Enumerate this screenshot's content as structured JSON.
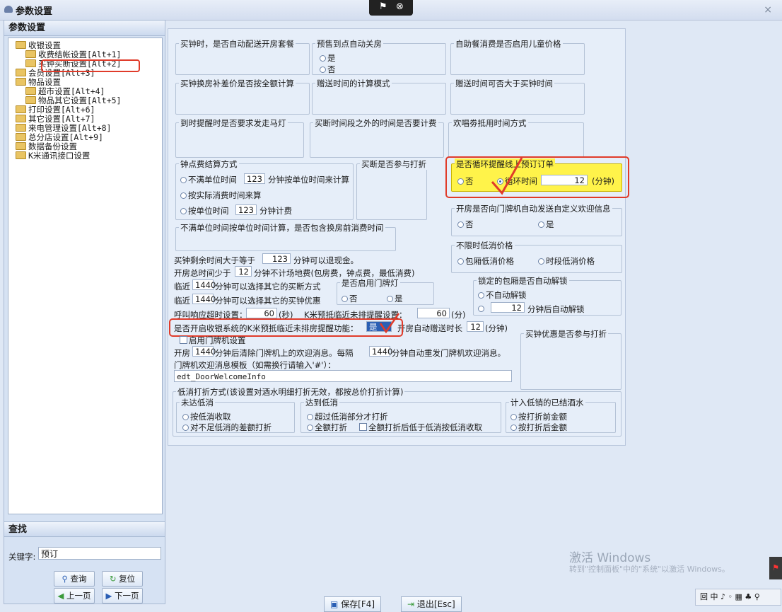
{
  "window": {
    "title": "参数设置",
    "close_glyph": "×",
    "rec_icon1": "⚑",
    "rec_icon2": "⊗"
  },
  "left": {
    "header": "参数设置",
    "tree": [
      "收银设置",
      "收费结帐设置[Alt+1]",
      "买钟买断设置[Alt+2]",
      "会员设置[Alt+3]",
      "物品设置",
      "超市设置[Alt+4]",
      "物品其它设置[Alt+5]",
      "打印设置[Alt+6]",
      "其它设置[Alt+7]",
      "来电管理设置[Alt+8]",
      "总分店设置[Alt+9]",
      "数据备份设置",
      "K米通讯接口设置"
    ],
    "search_header": "查找",
    "keyword_label": "关键字:",
    "keyword_value": "预订",
    "query_btn": "查询",
    "reset_btn": "复位",
    "prev_btn": "上一页",
    "next_btn": "下一页"
  },
  "groups": {
    "g1": "买钟时，是否自动配送开房套餐",
    "g2": "预售到点自动关房",
    "g2_yes": "是",
    "g2_no": "否",
    "g3": "自助餐消费是否启用儿童价格",
    "g4": "买钟换房补差价是否按全额计算",
    "g5": "赠送时间的计算模式",
    "g6": "赠送时间可否大于买钟时间",
    "g7": "到时提醒时是否要求发走马灯",
    "g8": "买断时间段之外的时间是否要计费",
    "g9": "欢唱劵抵用时间方式",
    "g10": "钟点费结算方式",
    "g10_opt1a": "不满单位时间",
    "g10_val1": "123",
    "g10_opt1b": "分钟按单位时间来计算",
    "g10_opt2": "按实际消费时间来算",
    "g10_opt3a": "按单位时间",
    "g10_val3": "123",
    "g10_opt3b": "分钟计费",
    "g11": "买断是否参与打折",
    "g12": "是否循环提醒线上预订订单",
    "g12_no": "否",
    "g12_cycle": "循环时间",
    "g12_val": "12",
    "g12_unit": "(分钟)",
    "g13": "开房是否向门牌机自动发送自定义欢迎信息",
    "g13_no": "否",
    "g13_yes": "是",
    "g14": "不满单位时间按单位时间计算，是否包含换房前消费时间",
    "g15": "不限时低消价格",
    "g15_a": "包厢低消价格",
    "g15_b": "时段低消价格",
    "g16": "锁定的包厢是否自动解锁",
    "g16_a": "不自动解锁",
    "g16_val": "12",
    "g16_b": "分钟后自动解锁",
    "g17": "是否启用门牌灯",
    "g17_no": "否",
    "g17_yes": "是",
    "g18": "买钟优惠是否参与打折"
  },
  "lines": {
    "l1a": "买钟剩余时间大于等于",
    "l1v": "123",
    "l1b": "分钟可以退现金。",
    "l2a": "开房总时间少于",
    "l2v": "12",
    "l2b": "分钟不计场地费(包房费，钟点费，最低消费)",
    "l3a": "临近",
    "l3v": "1440",
    "l3b": "分钟可以选择其它的买断方式",
    "l4a": "临近",
    "l4v": "1440",
    "l4b": "分钟可以选择其它的买钟优惠",
    "l5a": "呼叫响应超时设置：",
    "l5v": "60",
    "l5b": "(秒)",
    "l5c": "K米预抵临近未排提醒设置：",
    "l5v2": "60",
    "l5d": "(分)",
    "l6a": "是否开启收银系统的K米预抵临近未排房提醒功能：",
    "l6v": "是",
    "l6b": "开房自动赠送时长",
    "l6v2": "12",
    "l6c": "(分钟)",
    "l7": "启用门牌机设置",
    "l8a": "开房",
    "l8v": "1440",
    "l8b": "分钟后清除门牌机上的欢迎消息。每隔",
    "l8v2": "1440",
    "l8c": "分钟自动重发门牌机欢迎消息。",
    "l9": "门牌机欢迎消息模板（如需换行请输入'#'）：",
    "l10": "edt_DoorWelcomeInfo"
  },
  "discount": {
    "title": "低消打折方式(该设置对酒水明细打折无效，都按总价打折计算)",
    "a": "未达低消",
    "a1": "按低消收取",
    "a2": "对不足低消的差额打折",
    "b": "达到低消",
    "b1": "超过低消部分才打折",
    "b2": "全额打折",
    "b3": "全额打折后低于低消按低消收取",
    "c": "计入低销的已结酒水",
    "c1": "按打折前金额",
    "c2": "按打折后金额"
  },
  "bottom": {
    "save": "保存[F4]",
    "exit": "退出[Esc]"
  },
  "watermark": {
    "line1": "激活 Windows",
    "line2": "转到\"控制面板\"中的\"系统\"以激活 Windows。"
  },
  "taskbar": "回 中 ♪ ◦ ▦ ♣ ⚲",
  "colors": {
    "highlight": "#fff34a",
    "annotation": "#e03b2a",
    "panel_bg": "#e6eef9"
  }
}
